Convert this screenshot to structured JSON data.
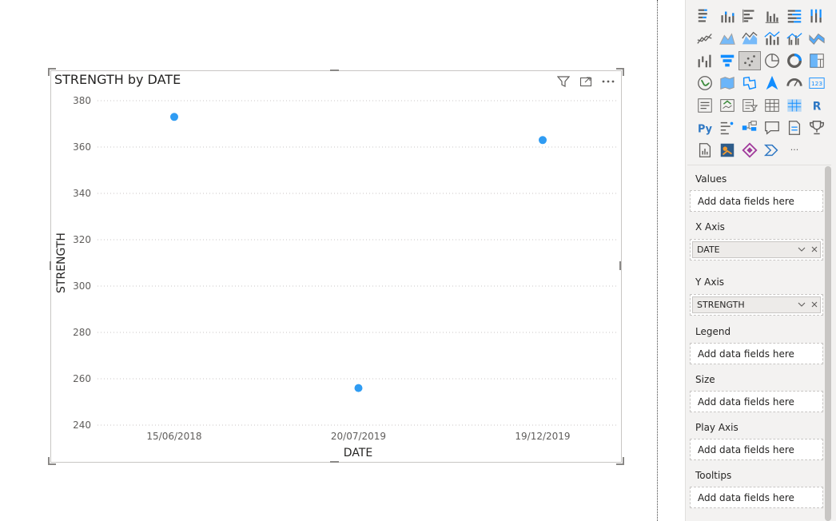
{
  "visual": {
    "title": "STRENGTH by DATE",
    "header_icons": [
      "filter-icon",
      "focus-mode-icon",
      "more-options-icon"
    ]
  },
  "chart_data": {
    "type": "scatter",
    "title": "STRENGTH by DATE",
    "xlabel": "DATE",
    "ylabel": "STRENGTH",
    "x": [
      "15/06/2018",
      "20/07/2019",
      "19/12/2019"
    ],
    "points": [
      {
        "x": "15/06/2018",
        "y": 373
      },
      {
        "x": "20/07/2019",
        "y": 256
      },
      {
        "x": "19/12/2019",
        "y": 363
      }
    ],
    "yticks": [
      240,
      260,
      280,
      300,
      320,
      340,
      360,
      380
    ],
    "ylim": [
      240,
      380
    ],
    "grid": true,
    "point_color": "#2f9cf3"
  },
  "panel": {
    "viz_icons": [
      [
        "stacked-bar-icon",
        "stacked-column-icon",
        "clustered-bar-icon",
        "clustered-column-icon",
        "100-bar-icon",
        "100-column-icon"
      ],
      [
        "line-chart-icon",
        "area-chart-icon",
        "stacked-area-icon",
        "line-column-icon",
        "line-clustered-column-icon",
        "ribbon-chart-icon"
      ],
      [
        "waterfall-icon",
        "funnel-icon",
        "scatter-icon",
        "pie-icon",
        "donut-icon",
        "treemap-icon"
      ],
      [
        "map-icon",
        "filled-map-icon",
        "shape-map-icon",
        "azure-map-icon",
        "gauge-icon",
        "card-icon"
      ],
      [
        "multi-row-card-icon",
        "kpi-icon",
        "slicer-icon",
        "table-icon",
        "matrix-icon",
        "r-visual-icon"
      ],
      [
        "python-visual-icon",
        "key-influencers-icon",
        "decomposition-tree-icon",
        "qna-icon",
        "smart-narrative-icon",
        "goals-icon"
      ],
      [
        "paginated-report-icon",
        "arcgis-icon",
        "power-apps-icon",
        "power-automate-icon",
        "more-visuals-icon"
      ]
    ],
    "selected_viz": "scatter-icon",
    "r_label": "R",
    "py_label": "Py",
    "card_label": "123",
    "more_label": "···",
    "wells": {
      "values": {
        "label": "Values",
        "placeholder": "Add data fields here"
      },
      "x_axis": {
        "label": "X Axis",
        "field": "DATE"
      },
      "y_axis": {
        "label": "Y Axis",
        "field": "STRENGTH"
      },
      "legend": {
        "label": "Legend",
        "placeholder": "Add data fields here"
      },
      "size": {
        "label": "Size",
        "placeholder": "Add data fields here"
      },
      "play_axis": {
        "label": "Play Axis",
        "placeholder": "Add data fields here"
      },
      "tooltips": {
        "label": "Tooltips",
        "placeholder": "Add data fields here"
      }
    },
    "accent": "#118dff"
  }
}
